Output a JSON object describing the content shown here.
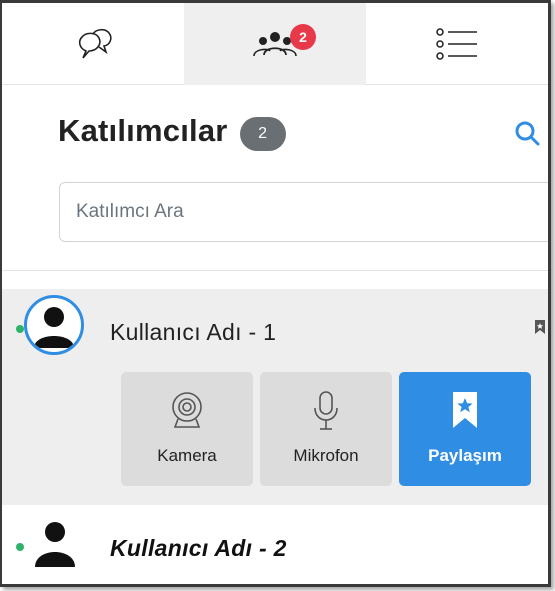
{
  "tabs": [
    {
      "name": "chat",
      "icon": "chat-bubbles-icon",
      "active": false
    },
    {
      "name": "participants",
      "icon": "people-icon",
      "active": true,
      "badge": "2"
    },
    {
      "name": "list",
      "icon": "list-icon",
      "active": false
    }
  ],
  "header": {
    "title": "Katılımcılar",
    "count": "2"
  },
  "search": {
    "placeholder": "Katılımcı Ara",
    "value": ""
  },
  "participants": [
    {
      "name": "Kullanıcı Adı - 1",
      "online": true,
      "expanded": true,
      "actions": [
        {
          "label": "Kamera",
          "icon": "webcam-icon",
          "active": false
        },
        {
          "label": "Mikrofon",
          "icon": "microphone-icon",
          "active": false
        },
        {
          "label": "Paylaşım",
          "icon": "bookmark-star-icon",
          "active": true
        }
      ]
    },
    {
      "name": "Kullanıcı Adı - 2",
      "online": true,
      "expanded": false
    }
  ],
  "colors": {
    "accent": "#2f8de4",
    "badge": "#e8394a",
    "online": "#2eb36c",
    "pill": "#6a6f74",
    "row_highlight": "#eeeeee",
    "button_bg": "#dcdcdc"
  }
}
